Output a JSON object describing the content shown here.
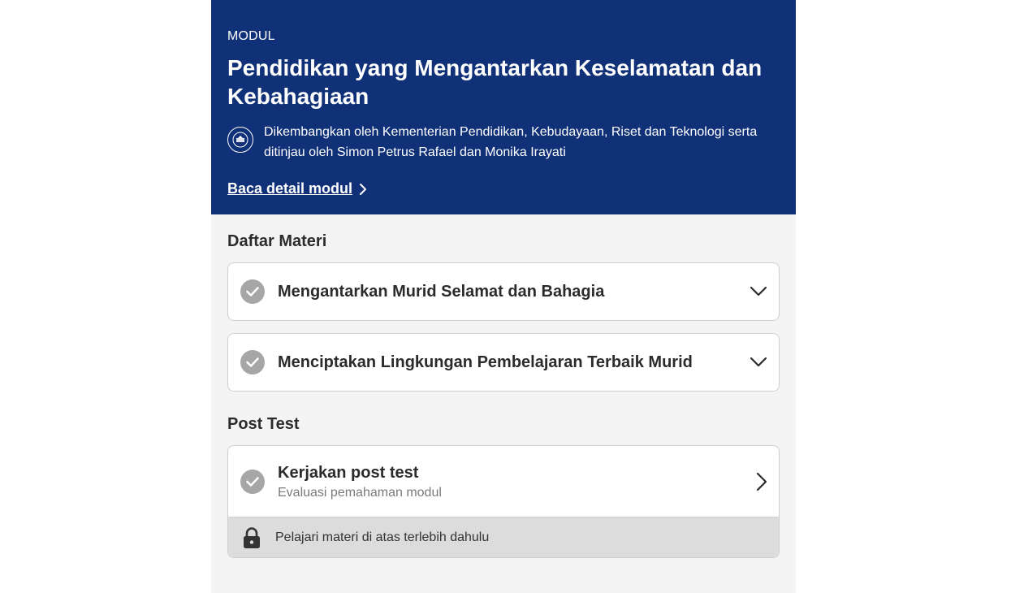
{
  "header": {
    "eyebrow": "MODUL",
    "title": "Pendidikan yang Mengantarkan Keselamatan dan Kebahagiaan",
    "byline": "Dikembangkan oleh Kementerian Pendidikan, Kebudayaan, Riset dan Teknologi serta ditinjau oleh Simon Petrus Rafael dan Monika Irayati",
    "detail_link": "Baca detail modul"
  },
  "materials": {
    "section_title": "Daftar Materi",
    "items": [
      {
        "label": "Mengantarkan Murid Selamat dan Bahagia",
        "icon": "check-circle-icon",
        "action_icon": "chevron-down-icon"
      },
      {
        "label": "Menciptakan Lingkungan Pembelajaran Terbaik Murid",
        "icon": "check-circle-icon",
        "action_icon": "chevron-down-icon"
      }
    ]
  },
  "post_test": {
    "section_title": "Post Test",
    "title": "Kerjakan post test",
    "subtitle": "Evaluasi pemahaman modul",
    "lock_message": "Pelajari materi di atas terlebih dahulu",
    "icon": "check-circle-icon",
    "lock_icon": "lock-icon"
  },
  "colors": {
    "header_bg": "#103178",
    "page_bg": "#f4f4f4",
    "check_gray": "#a6a6a6",
    "lock_bar_bg": "#dcdcdc"
  }
}
